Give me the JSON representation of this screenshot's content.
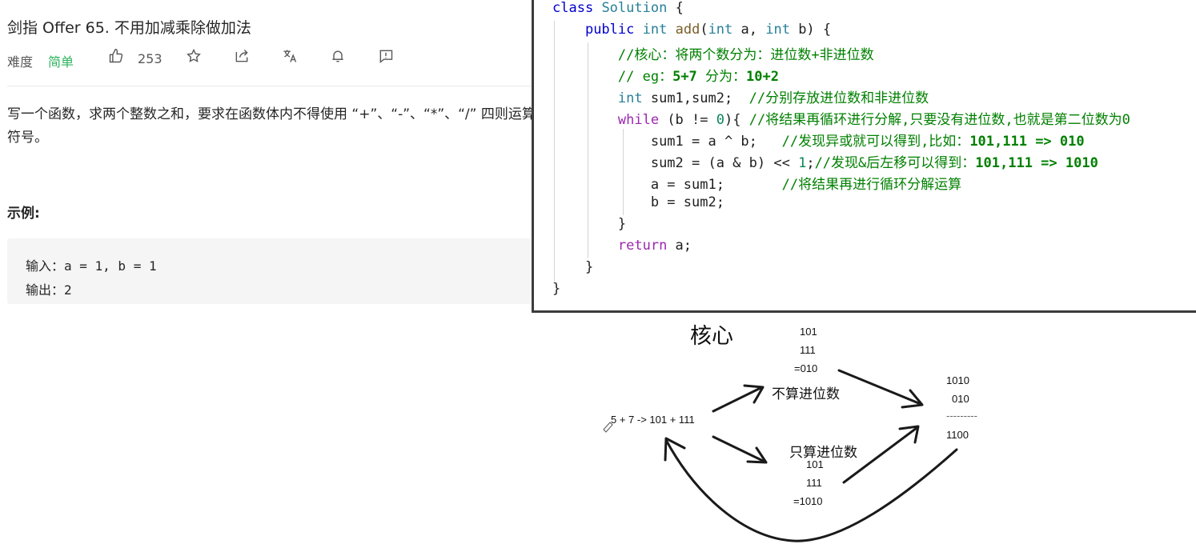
{
  "problem": {
    "title": "剑指 Offer 65. 不用加减乘除做加法",
    "difficulty_label": "难度",
    "difficulty": "简单",
    "likes": "253",
    "description": "写一个函数，求两个整数之和，要求在函数体内不得使用 “+”、“-”、“*”、“/” 四则运算符号。",
    "example_heading": "示例:",
    "example_input": "输入：a = 1, b = 1",
    "example_output": "输出：2"
  },
  "code": {
    "l1_a": "class",
    "l1_b": "Solution",
    "l1_c": "{",
    "l2_a": "public",
    "l2_b": "int",
    "l2_c": "add",
    "l2_d": "(",
    "l2_e": "int",
    "l2_f": " a, ",
    "l2_g": "int",
    "l2_h": " b) {",
    "l3": "//核心：将两个数分为：进位数+非进位数",
    "l4_a": "// eg：",
    "l4_b": "5+7",
    "l4_c": " 分为：",
    "l4_d": "10+2",
    "l5_a": "int",
    "l5_b": " sum1,sum2;  ",
    "l5_c": "//分别存放进位数和非进位数",
    "l6_a": "while",
    "l6_b": " (b != ",
    "l6_c": "0",
    "l6_d": "){ ",
    "l6_e": "//将结果再循环进行分解,只要没有进位数,也就是第二位数为0",
    "l7_a": "sum1 = a ^ b;   ",
    "l7_b": "//发现异或就可以得到,比如：",
    "l7_c": "101,111 => 010",
    "l8_a": "sum2 = (a & b) << ",
    "l8_b": "1",
    "l8_c": ";",
    "l8_d": "//发现&后左移可以得到：",
    "l8_e": "101,111 => 1010",
    "l9_a": "a = sum1;       ",
    "l9_b": "//将结果再进行循环分解运算",
    "l10": "b = sum2;",
    "l11": "}",
    "l12_a": "return",
    "l12_b": " a;",
    "l13": "}",
    "l14": "}"
  },
  "diagram": {
    "title": "核心",
    "xor_1": "101",
    "xor_2": "111",
    "xor_3": "=010",
    "no_carry_label": "不算进位数",
    "start": "5 + 7 -> 101 + 111",
    "carry_label": "只算进位数",
    "and_1": "101",
    "and_2": "111",
    "and_3": "=1010",
    "sum_1": "1010",
    "sum_2": "010",
    "sum_rule": "---------",
    "sum_3": "1100"
  }
}
